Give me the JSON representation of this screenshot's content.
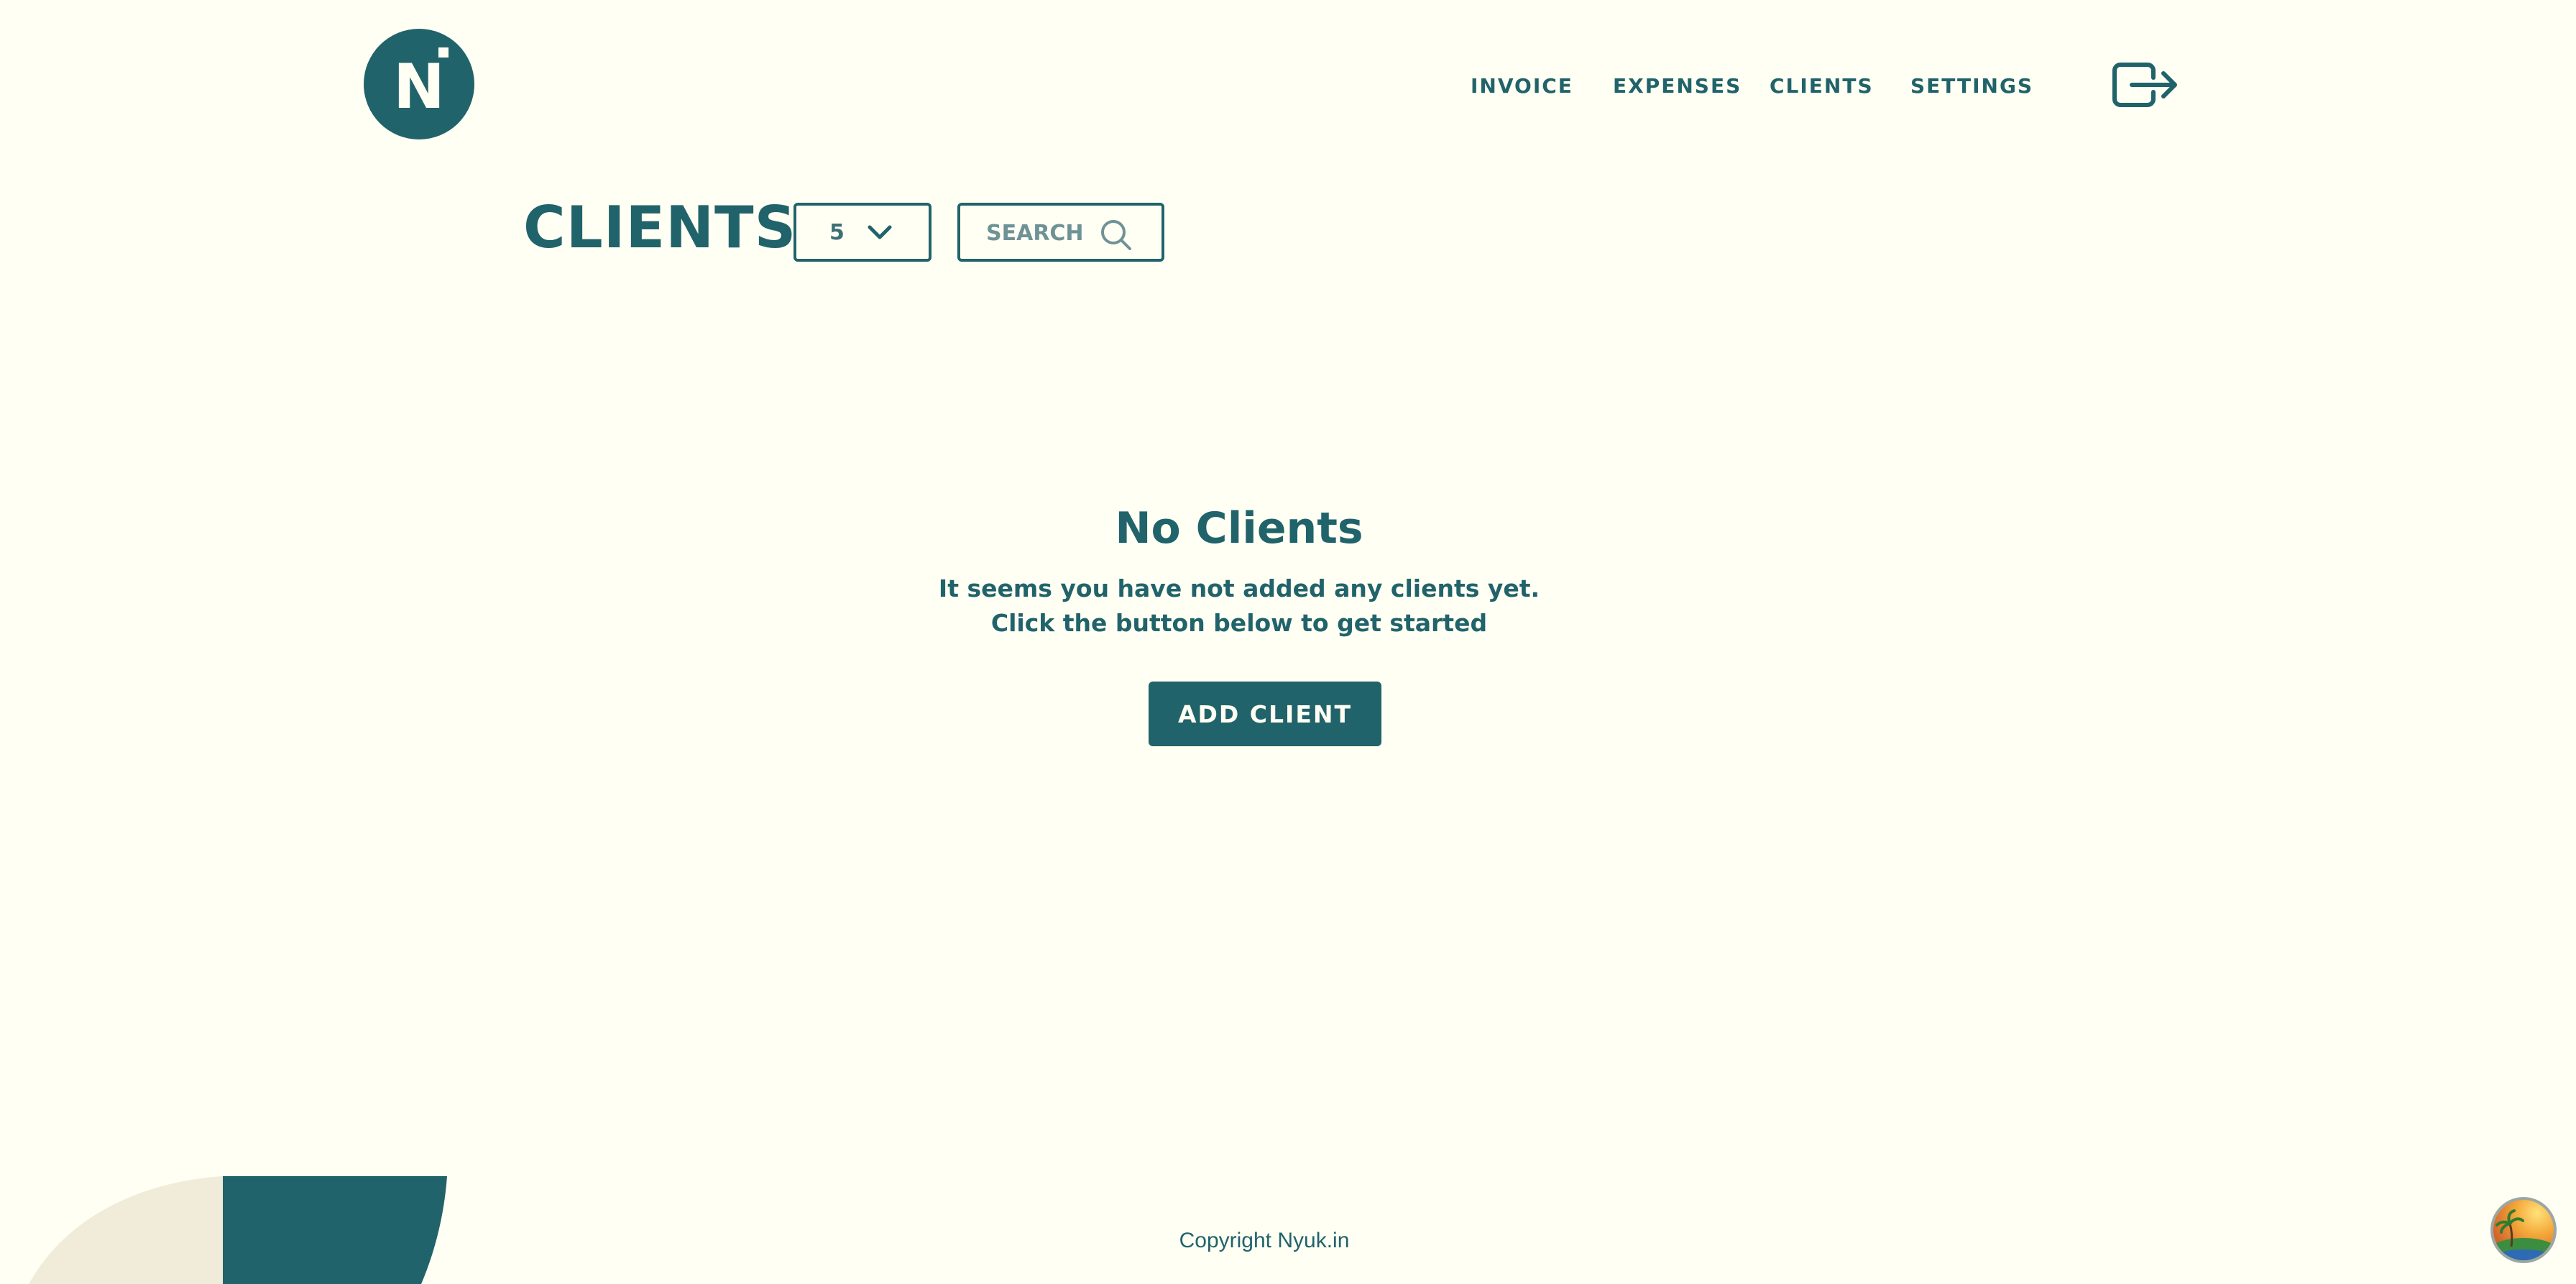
{
  "header": {
    "logo_text": "N",
    "nav": [
      {
        "label": "INVOICE"
      },
      {
        "label": "EXPENSES"
      },
      {
        "label": "CLIENTS"
      },
      {
        "label": "SETTINGS"
      }
    ],
    "logout_icon": "logout-icon"
  },
  "page": {
    "title": "CLIENTS",
    "page_size": {
      "value": "5",
      "icon": "chevron-down-icon"
    },
    "search": {
      "placeholder": "SEARCH",
      "value": "",
      "icon": "search-icon"
    }
  },
  "empty_state": {
    "title": "No Clients",
    "line1": "It seems you have not added any clients yet.",
    "line2": "Click the button below to get started",
    "button_label": "ADD CLIENT"
  },
  "footer": {
    "copyright": "Copyright Nyuk.in"
  },
  "colors": {
    "background": "#fffff3",
    "primary": "#21636b",
    "decoration_light": "#f1ecda"
  }
}
